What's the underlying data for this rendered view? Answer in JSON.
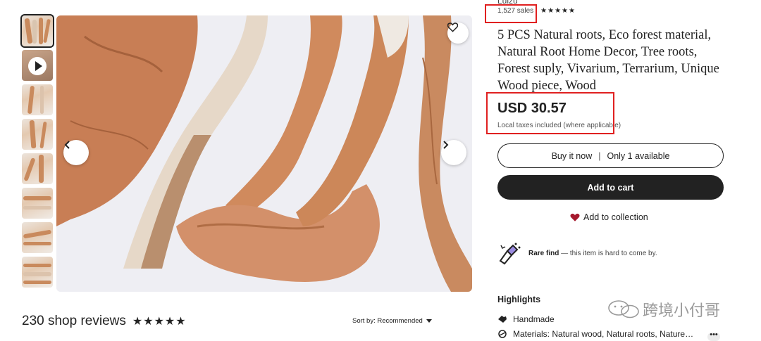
{
  "shop": {
    "name": "Lulzu"
  },
  "product": {
    "sales": "1,527 sales",
    "rating_stars": "★★★★★",
    "title": "5 PCS Natural roots, Eco forest material, Natural Root Home Decor, Tree roots, Forest suply, Vivarium, Terrarium, Unique Wood piece, Wood",
    "price": "USD 30.57",
    "tax_note": "Local taxes included (where applicable)"
  },
  "actions": {
    "buy_now": "Buy it now",
    "availability": "Only 1 available",
    "add_to_cart": "Add to cart",
    "add_to_collection": "Add to collection"
  },
  "rare_find": {
    "label": "Rare find",
    "text": " — this item is hard to come by."
  },
  "highlights": {
    "title": "Highlights",
    "items": [
      "Handmade",
      "Materials: Natural wood, Natural roots, Nature…"
    ],
    "more": "•••"
  },
  "reviews": {
    "text": "230 shop reviews",
    "stars": "★★★★★",
    "sort_label": "Sort by: Recommended"
  },
  "watermark": {
    "text": "跨境小付哥"
  },
  "colors": {
    "accent_dark": "#222222",
    "annotation_red": "#e02020",
    "heart_red": "#a61a2e"
  }
}
